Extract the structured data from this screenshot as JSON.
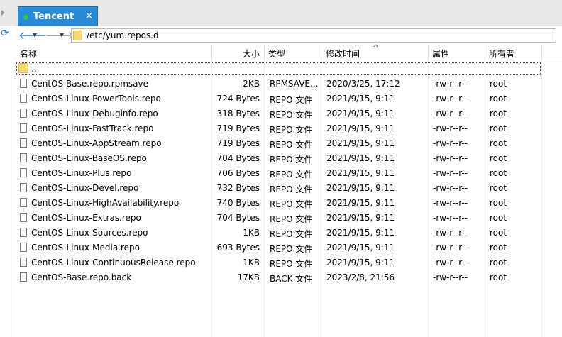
{
  "tab": {
    "title": "Tencent",
    "close": "×"
  },
  "address": {
    "path": "/etc/yum.repos.d"
  },
  "columns": {
    "name": "名称",
    "size": "大小",
    "type": "类型",
    "modified": "修改时间",
    "attributes": "属性",
    "owner": "所有者"
  },
  "parent_dir": "..",
  "files": [
    {
      "name": "CentOS-Base.repo.rpmsave",
      "size": "2KB",
      "type": "RPMSAVE...",
      "modified": "2020/3/25, 17:12",
      "attr": "-rw-r--r--",
      "owner": "root"
    },
    {
      "name": "CentOS-Linux-PowerTools.repo",
      "size": "724 Bytes",
      "type": "REPO 文件",
      "modified": "2021/9/15, 9:11",
      "attr": "-rw-r--r--",
      "owner": "root"
    },
    {
      "name": "CentOS-Linux-Debuginfo.repo",
      "size": "318 Bytes",
      "type": "REPO 文件",
      "modified": "2021/9/15, 9:11",
      "attr": "-rw-r--r--",
      "owner": "root"
    },
    {
      "name": "CentOS-Linux-FastTrack.repo",
      "size": "719 Bytes",
      "type": "REPO 文件",
      "modified": "2021/9/15, 9:11",
      "attr": "-rw-r--r--",
      "owner": "root"
    },
    {
      "name": "CentOS-Linux-AppStream.repo",
      "size": "719 Bytes",
      "type": "REPO 文件",
      "modified": "2021/9/15, 9:11",
      "attr": "-rw-r--r--",
      "owner": "root"
    },
    {
      "name": "CentOS-Linux-BaseOS.repo",
      "size": "704 Bytes",
      "type": "REPO 文件",
      "modified": "2021/9/15, 9:11",
      "attr": "-rw-r--r--",
      "owner": "root"
    },
    {
      "name": "CentOS-Linux-Plus.repo",
      "size": "706 Bytes",
      "type": "REPO 文件",
      "modified": "2021/9/15, 9:11",
      "attr": "-rw-r--r--",
      "owner": "root"
    },
    {
      "name": "CentOS-Linux-Devel.repo",
      "size": "732 Bytes",
      "type": "REPO 文件",
      "modified": "2021/9/15, 9:11",
      "attr": "-rw-r--r--",
      "owner": "root"
    },
    {
      "name": "CentOS-Linux-HighAvailability.repo",
      "size": "740 Bytes",
      "type": "REPO 文件",
      "modified": "2021/9/15, 9:11",
      "attr": "-rw-r--r--",
      "owner": "root"
    },
    {
      "name": "CentOS-Linux-Extras.repo",
      "size": "704 Bytes",
      "type": "REPO 文件",
      "modified": "2021/9/15, 9:11",
      "attr": "-rw-r--r--",
      "owner": "root"
    },
    {
      "name": "CentOS-Linux-Sources.repo",
      "size": "1KB",
      "type": "REPO 文件",
      "modified": "2021/9/15, 9:11",
      "attr": "-rw-r--r--",
      "owner": "root"
    },
    {
      "name": "CentOS-Linux-Media.repo",
      "size": "693 Bytes",
      "type": "REPO 文件",
      "modified": "2021/9/15, 9:11",
      "attr": "-rw-r--r--",
      "owner": "root"
    },
    {
      "name": "CentOS-Linux-ContinuousRelease.repo",
      "size": "1KB",
      "type": "REPO 文件",
      "modified": "2021/9/15, 9:11",
      "attr": "-rw-r--r--",
      "owner": "root"
    },
    {
      "name": "CentOS-Base.repo.back",
      "size": "17KB",
      "type": "BACK 文件",
      "modified": "2023/2/8, 21:56",
      "attr": "-rw-r--r--",
      "owner": "root"
    }
  ],
  "icons": {
    "back": "arrow-left-icon",
    "forward": "arrow-right-icon",
    "refresh": "refresh-icon",
    "folder": "folder-icon",
    "file": "file-icon",
    "sort": "sort-ascending-icon"
  },
  "colors": {
    "tab_active": "#2a8ad5",
    "status_dot": "#25d042",
    "folder": "#f8d775"
  }
}
